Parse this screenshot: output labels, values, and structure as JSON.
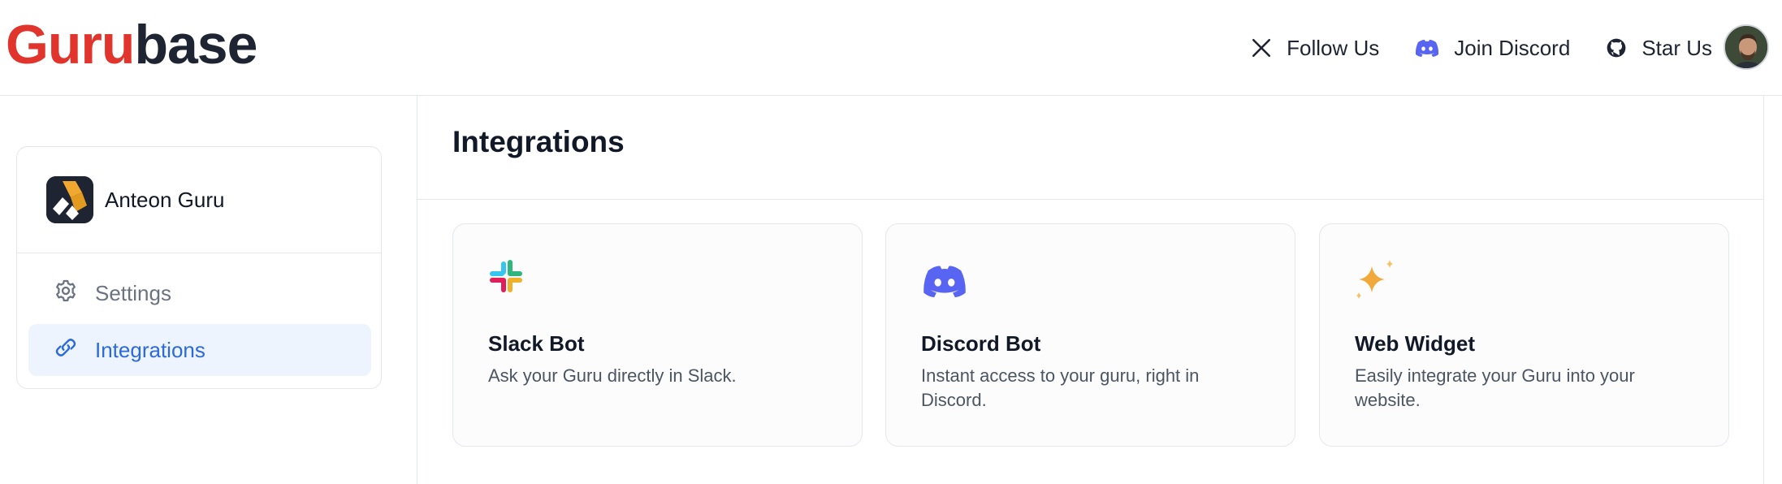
{
  "brand": {
    "part1": "Guru",
    "part2": "base",
    "primary_color": "#e1342c"
  },
  "nav": {
    "links": [
      {
        "label": "Follow Us",
        "icon": "x-icon"
      },
      {
        "label": "Join Discord",
        "icon": "discord-icon"
      },
      {
        "label": "Star Us",
        "icon": "github-icon"
      }
    ]
  },
  "sidebar": {
    "guru_name": "Anteon Guru",
    "items": [
      {
        "label": "Settings",
        "icon": "gear-icon",
        "active": false
      },
      {
        "label": "Integrations",
        "icon": "link-icon",
        "active": true
      }
    ],
    "active_color": "#2d6ad9"
  },
  "main": {
    "title": "Integrations",
    "cards": [
      {
        "title": "Slack Bot",
        "description": "Ask your Guru directly in Slack.",
        "icon": "slack-icon"
      },
      {
        "title": "Discord Bot",
        "description": "Instant access to your guru, right in Discord.",
        "icon": "discord-icon"
      },
      {
        "title": "Web Widget",
        "description": "Easily integrate your Guru into your website.",
        "icon": "sparkle-icon"
      }
    ]
  }
}
